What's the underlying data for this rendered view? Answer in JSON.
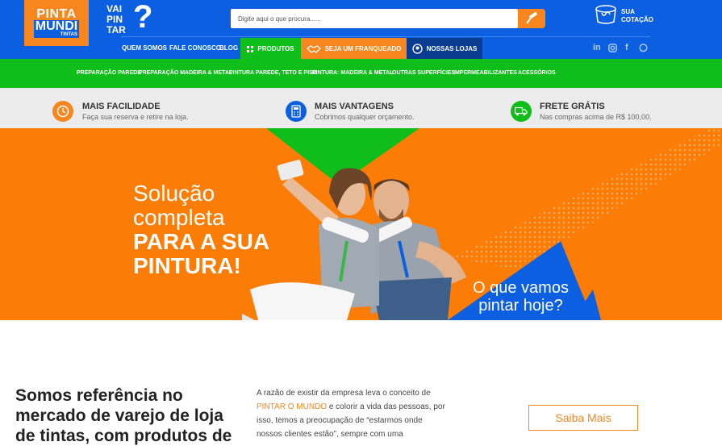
{
  "header": {
    "logo": {
      "line1": "PINTA",
      "line2": "MUNDI",
      "line3": "TINTAS"
    },
    "vai_pintar": {
      "w1": "VAI",
      "w2": "PIN",
      "w3": "TAR",
      "q": "?"
    },
    "search": {
      "placeholder": "Digite aqui o que procura......"
    },
    "quote": {
      "line1": "SUA",
      "line2": "COTAÇÃO"
    }
  },
  "nav": {
    "quem_somos": "QUEM SOMOS",
    "fale_conosco": "FALE CONOSCO",
    "blog": "BLOG",
    "produtos": "PRODUTOS",
    "franqueado": "SEJA UM FRANQUEADO",
    "lojas": "NOSSAS LOJAS"
  },
  "social": {
    "linkedin": "in",
    "facebook": "f"
  },
  "categories": [
    "PREPARAÇÃO PAREDE",
    "PREPARAÇÃO MADEIRA & METAL",
    "PINTURA PAREDE, TETO E PISO",
    "PINTURA: MADEIRA & METAL",
    "OUTRAS SUPERFÍCIES",
    "IMPERMEABILIZANTES",
    "ACESSÓRIOS"
  ],
  "features": [
    {
      "title": "MAIS FACILIDADE",
      "sub": "Faça sua reserva e retire na loja."
    },
    {
      "title": "MAIS VANTAGENS",
      "sub": "Cobrimos qualquer orçamento."
    },
    {
      "title": "FRETE GRÁTIS",
      "sub": "Nas compras acima de R$ 100,00."
    }
  ],
  "hero": {
    "line1": "Solução",
    "line2": "completa",
    "line3": "PARA A SUA",
    "line4": "PINTURA!",
    "cta1": "O que vamos",
    "cta2": "pintar hoje?"
  },
  "about": {
    "title": "Somos referência no mercado de varejo de loja de tintas, com produtos de",
    "text_before": "A razão de existir da empresa leva o conceito de ",
    "highlight": "PINTAR O MUNDO",
    "text_after": " e colorir a vida das pessoas, por isso, temos a preocupação de “estarmos onde nossos clientes estão”, sempre com uma",
    "button": "Saiba Mais"
  },
  "colors": {
    "blue": "#0b5fe0",
    "orange": "#f7861f",
    "green": "#0fbe1a",
    "navy": "#0a3d91"
  }
}
